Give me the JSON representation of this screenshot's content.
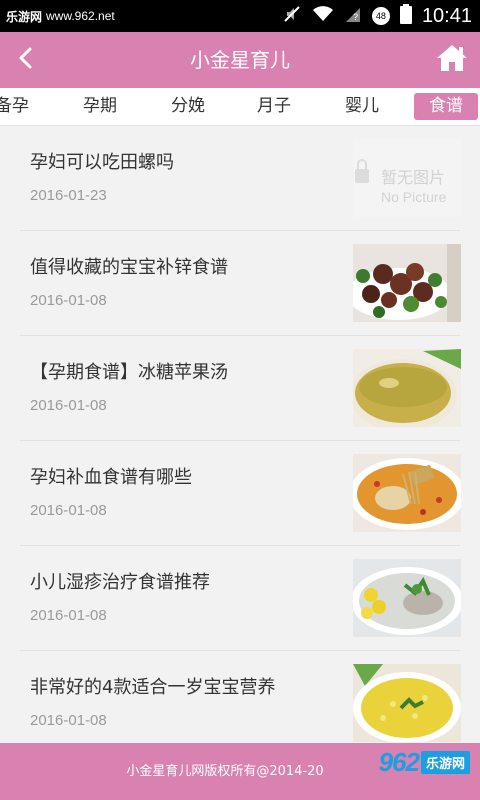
{
  "status_bar": {
    "watermark_label": "乐游网",
    "watermark_url": "www.962.net",
    "battery_badge": "48",
    "time": "10:41"
  },
  "header": {
    "title": "小金星育儿",
    "back_icon": "chevron-left-icon",
    "home_icon": "home-icon"
  },
  "tabs": [
    {
      "label": "备孕",
      "active": false
    },
    {
      "label": "孕期",
      "active": false
    },
    {
      "label": "分娩",
      "active": false
    },
    {
      "label": "月子",
      "active": false
    },
    {
      "label": "婴儿",
      "active": false
    },
    {
      "label": "食谱",
      "active": true
    }
  ],
  "articles": [
    {
      "title": "孕妇可以吃田螺吗",
      "date": "2016-01-23",
      "thumb_placeholder": [
        "暂无图片",
        "No Picture"
      ]
    },
    {
      "title": "值得收藏的宝宝补锌食谱",
      "date": "2016-01-08"
    },
    {
      "title": "【孕期食谱】冰糖苹果汤",
      "date": "2016-01-08"
    },
    {
      "title": "孕妇补血食谱有哪些",
      "date": "2016-01-08"
    },
    {
      "title": "小儿湿疹治疗食谱推荐",
      "date": "2016-01-08"
    },
    {
      "title": "非常好的4款适合一岁宝宝营养",
      "date": "2016-01-08"
    }
  ],
  "footer": {
    "copyright": "小金星育儿网版权所有@2014-20",
    "watermark_num": "962",
    "watermark_txt": "乐游网"
  },
  "colors": {
    "brand": "#d981b0",
    "text": "#333333",
    "date": "#9a9a9a"
  }
}
